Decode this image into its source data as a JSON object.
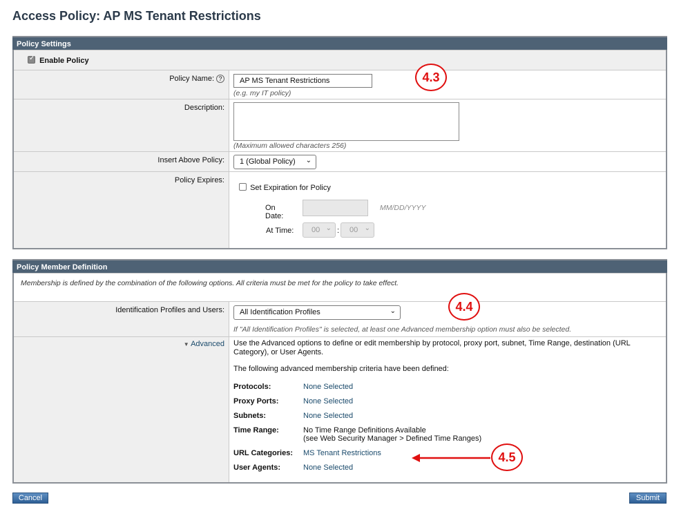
{
  "page_title": "Access Policy: AP MS Tenant Restrictions",
  "settings": {
    "header": "Policy Settings",
    "enable_label": "Enable Policy",
    "name_label": "Policy Name:",
    "help_glyph": "?",
    "name_value": "AP MS Tenant Restrictions",
    "name_hint": "(e.g. my IT policy)",
    "desc_label": "Description:",
    "desc_hint": "(Maximum allowed characters 256)",
    "insert_label": "Insert Above Policy:",
    "insert_value": "1 (Global Policy)",
    "expires_label": "Policy Expires:",
    "set_exp_label": "Set Expiration for Policy",
    "on_date_label": "On Date:",
    "date_placeholder": "MM/DD/YYYY",
    "at_time_label": "At Time:",
    "hour_value": "00",
    "minute_value": "00",
    "time_sep": ":"
  },
  "member": {
    "header": "Policy Member Definition",
    "intro": "Membership is defined by the combination of the following options. All criteria must be met for the policy to take effect.",
    "id_label": "Identification Profiles and Users:",
    "id_value": "All Identification Profiles",
    "id_hint": "If \"All Identification Profiles\" is selected, at least one Advanced membership option must also be selected.",
    "advanced_label": "Advanced",
    "advanced_desc": "Use the Advanced options to define or edit membership by protocol, proxy port, subnet, Time Range, destination (URL Category), or User Agents.",
    "criteria_intro": "The following advanced membership criteria have been defined:",
    "criteria": [
      {
        "key": "Protocols:",
        "value": "None Selected",
        "link": true
      },
      {
        "key": "Proxy Ports:",
        "value": "None Selected",
        "link": true
      },
      {
        "key": "Subnets:",
        "value": "None Selected",
        "link": true
      },
      {
        "key": "Time Range:",
        "value": "No Time Range Definitions Available",
        "value2": "(see Web Security Manager > Defined Time Ranges)",
        "link": false
      },
      {
        "key": "URL Categories:",
        "value": "MS Tenant Restrictions",
        "link": true
      },
      {
        "key": "User Agents:",
        "value": "None Selected",
        "link": true
      }
    ]
  },
  "annotations": {
    "a1": "4.3",
    "a2": "4.4",
    "a3": "4.5"
  },
  "buttons": {
    "cancel": "Cancel",
    "submit": "Submit"
  },
  "colors": {
    "header_bg": "#4e6275",
    "callout": "#e01010",
    "link": "#1a4a6b"
  }
}
